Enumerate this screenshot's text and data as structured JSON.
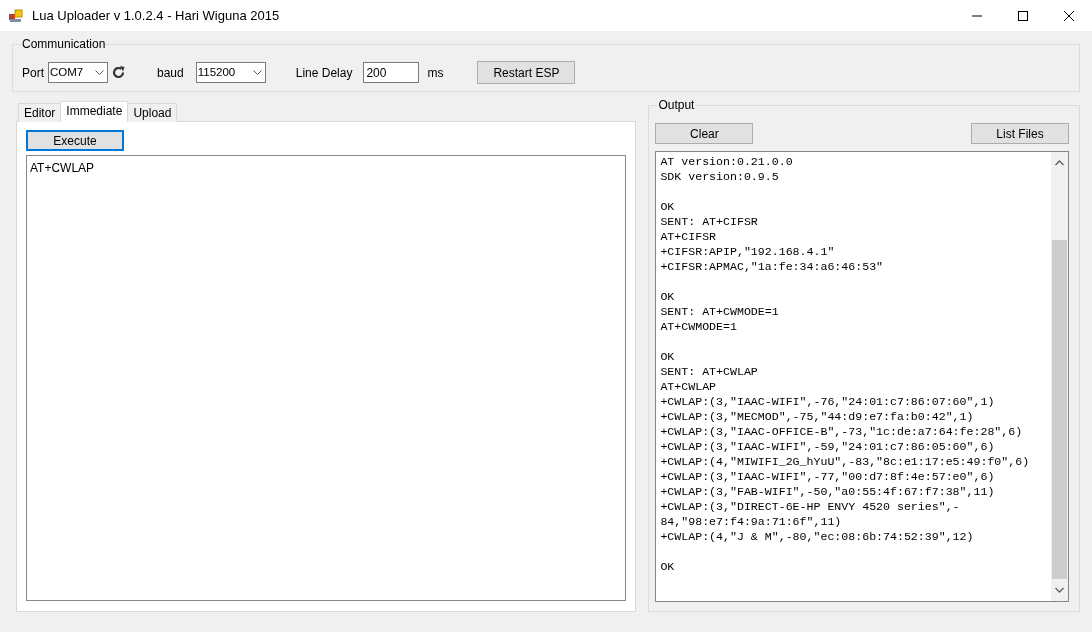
{
  "window": {
    "title": "Lua Uploader v 1.0.2.4 - Hari Wiguna 2015"
  },
  "communication": {
    "title": "Communication",
    "port_label": "Port",
    "port": "COM7",
    "baud_label": "baud",
    "baud": "115200",
    "line_delay_label": "Line Delay",
    "line_delay": "200",
    "unit": "ms",
    "restart_button": "Restart ESP"
  },
  "tabs": [
    {
      "label": "Editor",
      "selected": false
    },
    {
      "label": "Immediate",
      "selected": true
    },
    {
      "label": "Upload",
      "selected": false
    }
  ],
  "immediate": {
    "execute_button": "Execute",
    "command": "AT+CWLAP"
  },
  "output": {
    "title": "Output",
    "clear_button": "Clear",
    "list_files_button": "List Files",
    "blocks": [
      [
        "AT version:0.21.0.0",
        "SDK version:0.9.5"
      ],
      [
        "OK",
        "SENT: AT+CIFSR",
        "AT+CIFSR",
        "+CIFSR:APIP,\"192.168.4.1\"",
        "+CIFSR:APMAC,\"1a:fe:34:a6:46:53\""
      ],
      [
        "OK",
        "SENT: AT+CWMODE=1",
        "AT+CWMODE=1"
      ],
      [
        "OK",
        "SENT: AT+CWLAP",
        "AT+CWLAP",
        "+CWLAP:(3,\"IAAC-WIFI\",-76,\"24:01:c7:86:07:60\",1)",
        "+CWLAP:(3,\"MECMOD\",-75,\"44:d9:e7:fa:b0:42\",1)",
        "+CWLAP:(3,\"IAAC-OFFICE-B\",-73,\"1c:de:a7:64:fe:28\",6)",
        "+CWLAP:(3,\"IAAC-WIFI\",-59,\"24:01:c7:86:05:60\",6)",
        "+CWLAP:(4,\"MIWIFI_2G_hYuU\",-83,\"8c:e1:17:e5:49:f0\",6)",
        "+CWLAP:(3,\"IAAC-WIFI\",-77,\"00:d7:8f:4e:57:e0\",6)",
        "+CWLAP:(3,\"FAB-WIFI\",-50,\"a0:55:4f:67:f7:38\",11)",
        "+CWLAP:(3,\"DIRECT-6E-HP ENVY 4520 series\",-",
        "84,\"98:e7:f4:9a:71:6f\",11)",
        "+CWLAP:(4,\"J & M\",-80,\"ec:08:6b:74:52:39\",12)"
      ],
      [
        "OK"
      ]
    ]
  }
}
